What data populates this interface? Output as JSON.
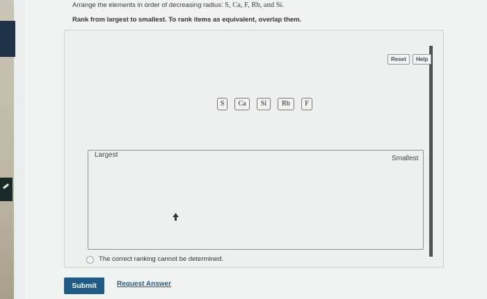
{
  "question": {
    "prompt_prefix": "Arrange the elements in order of decreasing radius:",
    "prompt_elements": "S, Ca, F, Rb, and Si.",
    "instructions": "Rank from largest to smallest. To rank items as equivalent, overlap them."
  },
  "toolbar": {
    "reset_label": "Reset",
    "help_label": "Help"
  },
  "tiles": [
    "S",
    "Ca",
    "Si",
    "Rb",
    "F"
  ],
  "ranking": {
    "largest_label": "Largest",
    "smallest_label": "Smallest"
  },
  "cannot_determine_label": "The correct ranking cannot be determined.",
  "footer": {
    "submit_label": "Submit",
    "request_answer_label": "Request Answer"
  },
  "colors": {
    "submit_bg": "#1d5b86",
    "link": "#1e5f8e"
  }
}
